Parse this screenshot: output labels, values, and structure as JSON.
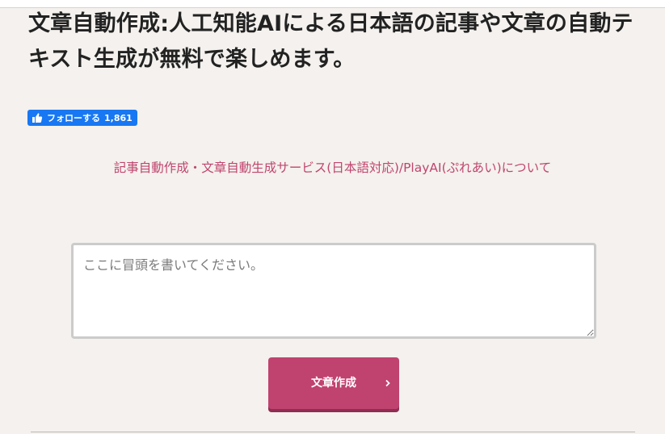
{
  "page": {
    "title": "文章自動作成:人工知能AIによる日本語の記事や文章の自動テキスト生成が無料で楽しめます。"
  },
  "facebook": {
    "follow_label": "フォローする",
    "follow_count": "1,861",
    "icon": "thumbs-up-icon",
    "color": "#1877f2"
  },
  "about_link": {
    "text": "記事自動作成・文章自動生成サービス(日本語対応)/PlayAI(ぷれあい)について",
    "color": "#c0456f"
  },
  "prompt": {
    "value": "",
    "placeholder": "ここに冒頭を書いてください。"
  },
  "generate_button": {
    "label": "文章作成",
    "icon": "chevron-right-icon",
    "color": "#c0426f"
  },
  "colors": {
    "background": "#f4f1ee",
    "accent": "#c0426f"
  }
}
